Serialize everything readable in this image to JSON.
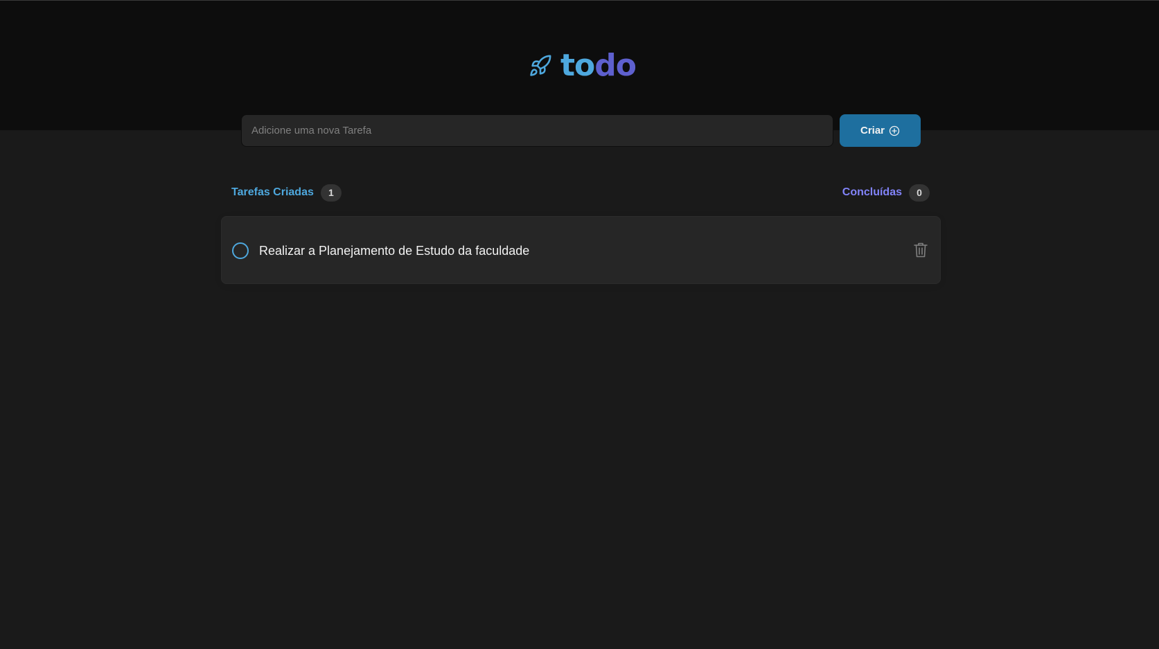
{
  "header": {
    "logo": {
      "icon": "rocket-icon",
      "text_part1": "to",
      "text_part2": "do"
    }
  },
  "form": {
    "input_placeholder": "Adicione uma nova Tarefa",
    "input_value": "",
    "create_label": "Criar",
    "create_icon": "plus-circle-icon"
  },
  "counters": {
    "created": {
      "label": "Tarefas Criadas",
      "count": "1"
    },
    "done": {
      "label": "Concluídas",
      "count": "0"
    }
  },
  "tasks": [
    {
      "text": "Realizar a Planejamento de Estudo da faculdade",
      "completed": false,
      "delete_icon": "trash-icon"
    }
  ],
  "colors": {
    "header_bg": "#0d0d0d",
    "page_bg": "#1a1a1a",
    "blue": "#4ea8de",
    "purple": "#5e60ce",
    "purple_light": "#8284fa",
    "button_bg": "#1e6f9f"
  }
}
